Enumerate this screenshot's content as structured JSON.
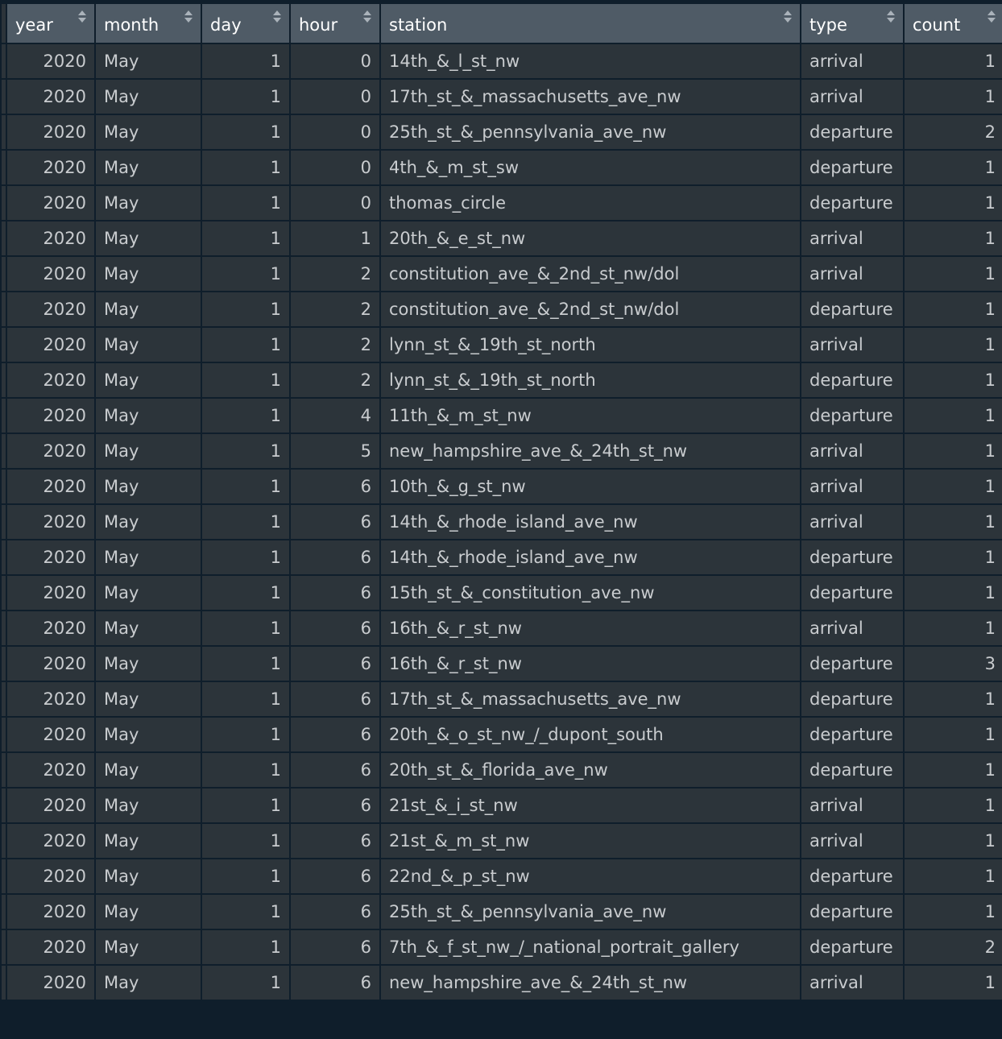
{
  "columns": [
    {
      "label": "year",
      "align": "num"
    },
    {
      "label": "month",
      "align": "text"
    },
    {
      "label": "day",
      "align": "num"
    },
    {
      "label": "hour",
      "align": "num"
    },
    {
      "label": "station",
      "align": "text"
    },
    {
      "label": "type",
      "align": "text"
    },
    {
      "label": "count",
      "align": "num"
    }
  ],
  "rows": [
    [
      "2020",
      "May",
      "1",
      "0",
      "14th_&_l_st_nw",
      "arrival",
      "1"
    ],
    [
      "2020",
      "May",
      "1",
      "0",
      "17th_st_&_massachusetts_ave_nw",
      "arrival",
      "1"
    ],
    [
      "2020",
      "May",
      "1",
      "0",
      "25th_st_&_pennsylvania_ave_nw",
      "departure",
      "2"
    ],
    [
      "2020",
      "May",
      "1",
      "0",
      "4th_&_m_st_sw",
      "departure",
      "1"
    ],
    [
      "2020",
      "May",
      "1",
      "0",
      "thomas_circle",
      "departure",
      "1"
    ],
    [
      "2020",
      "May",
      "1",
      "1",
      "20th_&_e_st_nw",
      "arrival",
      "1"
    ],
    [
      "2020",
      "May",
      "1",
      "2",
      "constitution_ave_&_2nd_st_nw/dol",
      "arrival",
      "1"
    ],
    [
      "2020",
      "May",
      "1",
      "2",
      "constitution_ave_&_2nd_st_nw/dol",
      "departure",
      "1"
    ],
    [
      "2020",
      "May",
      "1",
      "2",
      "lynn_st_&_19th_st_north",
      "arrival",
      "1"
    ],
    [
      "2020",
      "May",
      "1",
      "2",
      "lynn_st_&_19th_st_north",
      "departure",
      "1"
    ],
    [
      "2020",
      "May",
      "1",
      "4",
      "11th_&_m_st_nw",
      "departure",
      "1"
    ],
    [
      "2020",
      "May",
      "1",
      "5",
      "new_hampshire_ave_&_24th_st_nw",
      "arrival",
      "1"
    ],
    [
      "2020",
      "May",
      "1",
      "6",
      "10th_&_g_st_nw",
      "arrival",
      "1"
    ],
    [
      "2020",
      "May",
      "1",
      "6",
      "14th_&_rhode_island_ave_nw",
      "arrival",
      "1"
    ],
    [
      "2020",
      "May",
      "1",
      "6",
      "14th_&_rhode_island_ave_nw",
      "departure",
      "1"
    ],
    [
      "2020",
      "May",
      "1",
      "6",
      "15th_st_&_constitution_ave_nw",
      "departure",
      "1"
    ],
    [
      "2020",
      "May",
      "1",
      "6",
      "16th_&_r_st_nw",
      "arrival",
      "1"
    ],
    [
      "2020",
      "May",
      "1",
      "6",
      "16th_&_r_st_nw",
      "departure",
      "3"
    ],
    [
      "2020",
      "May",
      "1",
      "6",
      "17th_st_&_massachusetts_ave_nw",
      "departure",
      "1"
    ],
    [
      "2020",
      "May",
      "1",
      "6",
      "20th_&_o_st_nw_/_dupont_south",
      "departure",
      "1"
    ],
    [
      "2020",
      "May",
      "1",
      "6",
      "20th_st_&_florida_ave_nw",
      "departure",
      "1"
    ],
    [
      "2020",
      "May",
      "1",
      "6",
      "21st_&_i_st_nw",
      "arrival",
      "1"
    ],
    [
      "2020",
      "May",
      "1",
      "6",
      "21st_&_m_st_nw",
      "arrival",
      "1"
    ],
    [
      "2020",
      "May",
      "1",
      "6",
      "22nd_&_p_st_nw",
      "departure",
      "1"
    ],
    [
      "2020",
      "May",
      "1",
      "6",
      "25th_st_&_pennsylvania_ave_nw",
      "departure",
      "1"
    ],
    [
      "2020",
      "May",
      "1",
      "6",
      "7th_&_f_st_nw_/_national_portrait_gallery",
      "departure",
      "2"
    ],
    [
      "2020",
      "May",
      "1",
      "6",
      "new_hampshire_ave_&_24th_st_nw",
      "arrival",
      "1"
    ]
  ]
}
